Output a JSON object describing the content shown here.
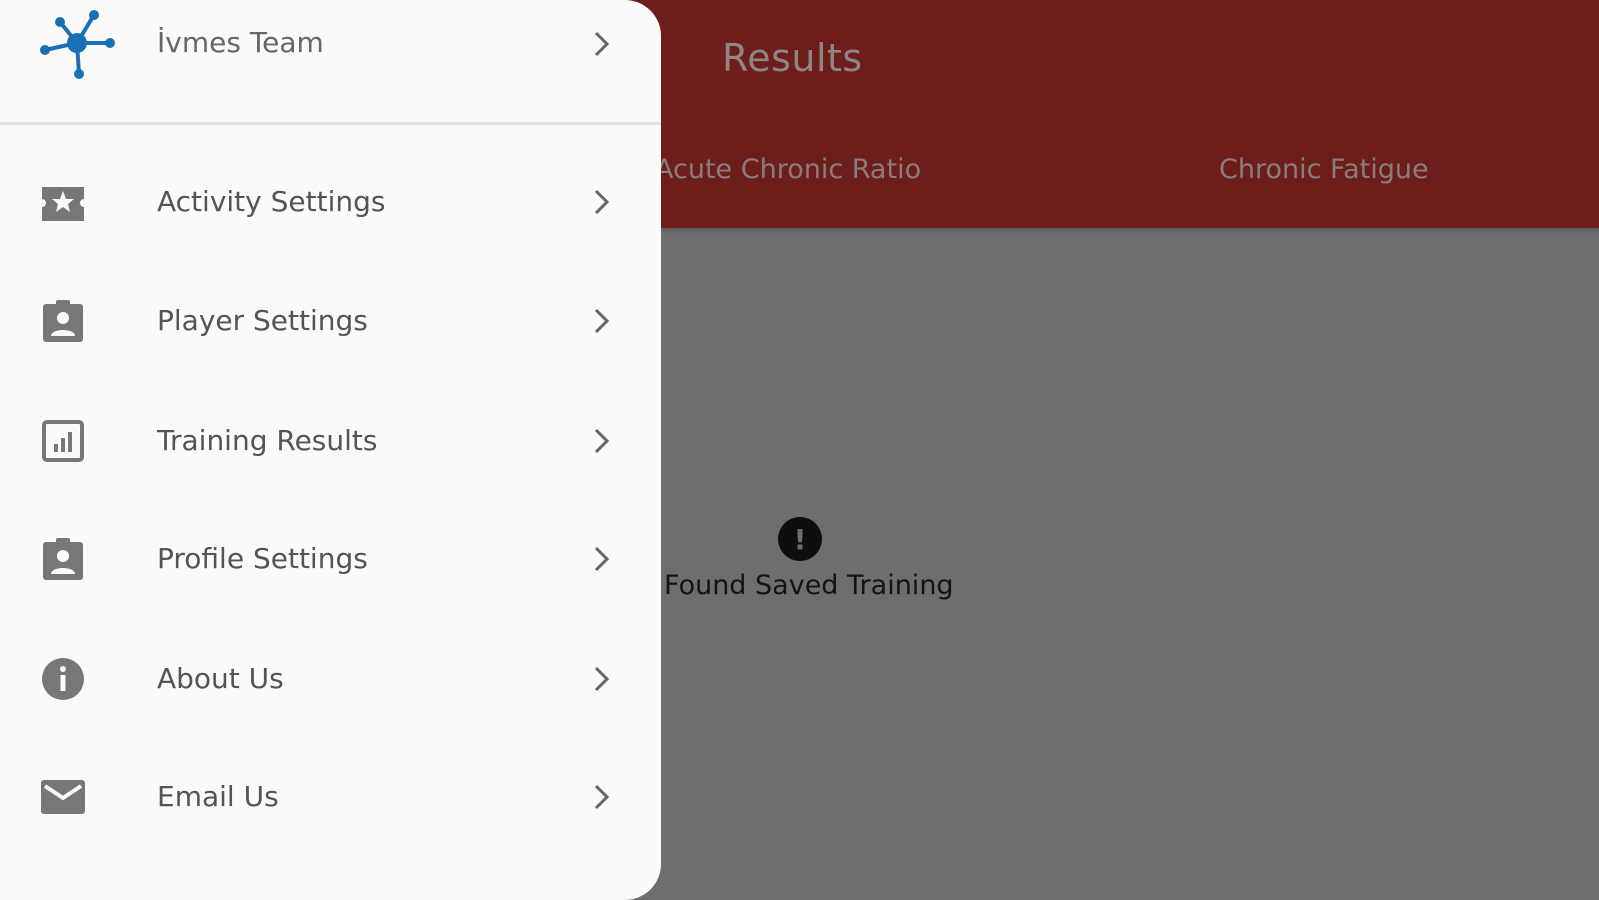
{
  "appbar": {
    "title": "Results",
    "tabs": [
      "Acute Chronic Ratio",
      "Chronic Fatigue"
    ]
  },
  "empty_state": {
    "icon": "exclamation-circle-icon",
    "message": "Found Saved Training"
  },
  "drawer": {
    "header": {
      "label": "İvmes Team",
      "icon": "network-hub-icon"
    },
    "items": [
      {
        "label": "Activity Settings",
        "icon": "star-badge-icon"
      },
      {
        "label": "Player Settings",
        "icon": "contact-badge-icon"
      },
      {
        "label": "Training Results",
        "icon": "bar-chart-icon"
      },
      {
        "label": "Profile Settings",
        "icon": "contact-badge-icon"
      },
      {
        "label": "About Us",
        "icon": "info-icon"
      },
      {
        "label": "Email Us",
        "icon": "mail-icon"
      }
    ]
  },
  "colors": {
    "appbar": "#6d1e1a",
    "scrim_background": "#6e6e6e",
    "drawer_background": "#fafafa",
    "brand_blue": "#1b6fb5",
    "icon_gray": "#777777"
  }
}
